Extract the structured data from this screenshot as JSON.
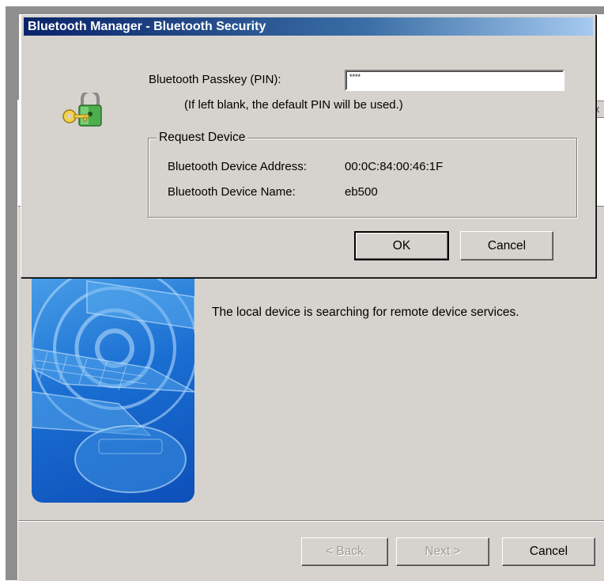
{
  "dialog": {
    "title": "Bluetooth Manager - Bluetooth Security",
    "pin_label": "Bluetooth Passkey (PIN):",
    "pin_value": "****",
    "pin_hint": "(If left blank, the default PIN will be used.)",
    "group_title": "Request Device",
    "address_label": "Bluetooth Device Address:",
    "address_value": "00:0C:84:00:46:1F",
    "name_label": "Bluetooth Device Name:",
    "name_value": "eb500",
    "ok_label": "OK",
    "cancel_label": "Cancel"
  },
  "wizard": {
    "status_text": "The local device is searching for remote device services.",
    "back_label": "< Back",
    "next_label": "Next >",
    "cancel_label": "Cancel",
    "close_glyph": "x"
  },
  "icons": {
    "dialog_icon": "lock-key-icon",
    "art": "bluetooth-search-illustration"
  },
  "colors": {
    "titlebar_start": "#0a246a",
    "titlebar_end": "#a6caf0",
    "face": "#d6d3ce",
    "art_blue": "#1a6fd2"
  }
}
